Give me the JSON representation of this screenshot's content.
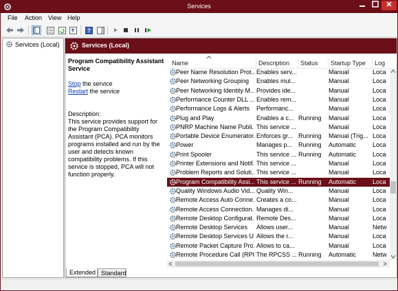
{
  "window": {
    "title": "Services"
  },
  "menu": [
    "File",
    "Action",
    "View",
    "Help"
  ],
  "tree": {
    "root_label": "Services (Local)"
  },
  "content": {
    "title": "Services (Local)",
    "service_title": "Program Compatibility Assistant Service",
    "stop_link": "Stop",
    "stop_suffix": " the service",
    "restart_link": "Restart",
    "restart_suffix": " the service",
    "description_label": "Description:",
    "description_text": "This service provides support for the Program Compatibility Assistant (PCA).  PCA monitors programs installed and run by the user and detects known compatibility problems. If this service is stopped, PCA will not function properly."
  },
  "columns": {
    "name": "Name",
    "description": "Description",
    "status": "Status",
    "startup": "Startup Type",
    "log": "Log"
  },
  "rows": [
    {
      "name": "Peer Name Resolution Prot...",
      "description": "Enables serv...",
      "status": "",
      "startup": "Manual",
      "log": "Loca"
    },
    {
      "name": "Peer Networking Grouping",
      "description": "Enables mul...",
      "status": "",
      "startup": "Manual",
      "log": "Loca"
    },
    {
      "name": "Peer Networking Identity M...",
      "description": "Provides ide...",
      "status": "",
      "startup": "Manual",
      "log": "Loca"
    },
    {
      "name": "Performance Counter DLL ...",
      "description": "Enables rem...",
      "status": "",
      "startup": "Manual",
      "log": "Loca"
    },
    {
      "name": "Performance Logs & Alerts",
      "description": "Performanc...",
      "status": "",
      "startup": "Manual",
      "log": "Loca"
    },
    {
      "name": "Plug and Play",
      "description": "Enables a c...",
      "status": "Running",
      "startup": "Manual",
      "log": "Loca"
    },
    {
      "name": "PNRP Machine Name Publi...",
      "description": "This service ...",
      "status": "",
      "startup": "Manual",
      "log": "Loca"
    },
    {
      "name": "Portable Device Enumerator...",
      "description": "Enforces gr...",
      "status": "Running",
      "startup": "Manual (Trig...",
      "log": "Loca"
    },
    {
      "name": "Power",
      "description": "Manages p...",
      "status": "Running",
      "startup": "Automatic",
      "log": "Loca"
    },
    {
      "name": "Print Spooler",
      "description": "This service ...",
      "status": "Running",
      "startup": "Automatic",
      "log": "Loca"
    },
    {
      "name": "Printer Extensions and Notif...",
      "description": "This service ...",
      "status": "",
      "startup": "Manual",
      "log": "Loca"
    },
    {
      "name": "Problem Reports and Soluti...",
      "description": "This service ...",
      "status": "",
      "startup": "Manual",
      "log": "Loca"
    },
    {
      "name": "Program Compatibility Assi...",
      "description": "This service ...",
      "status": "Running",
      "startup": "Automatic",
      "log": "Loca",
      "selected": true
    },
    {
      "name": "Quality Windows Audio Vid...",
      "description": "Quality Win...",
      "status": "",
      "startup": "Manual",
      "log": "Loca"
    },
    {
      "name": "Remote Access Auto Conne...",
      "description": "Creates a co...",
      "status": "",
      "startup": "Manual",
      "log": "Loca"
    },
    {
      "name": "Remote Access Connection...",
      "description": "Manages di...",
      "status": "",
      "startup": "Manual",
      "log": "Loca"
    },
    {
      "name": "Remote Desktop Configurat...",
      "description": "Remote Des...",
      "status": "",
      "startup": "Manual",
      "log": "Loca"
    },
    {
      "name": "Remote Desktop Services",
      "description": "Allows user...",
      "status": "",
      "startup": "Manual",
      "log": "Netw"
    },
    {
      "name": "Remote Desktop Services U...",
      "description": "Allows the r...",
      "status": "",
      "startup": "Manual",
      "log": "Loca"
    },
    {
      "name": "Remote Packet Capture Pro...",
      "description": "Allows to ca...",
      "status": "",
      "startup": "Manual",
      "log": "Loca"
    },
    {
      "name": "Remote Procedure Call (RPC)",
      "description": "The RPCSS ...",
      "status": "Running",
      "startup": "Automatic",
      "log": "Netw"
    }
  ],
  "tabs": [
    "Extended",
    "Standard"
  ],
  "colors": {
    "accent": "#6b0f19",
    "link": "#0a37b4"
  }
}
